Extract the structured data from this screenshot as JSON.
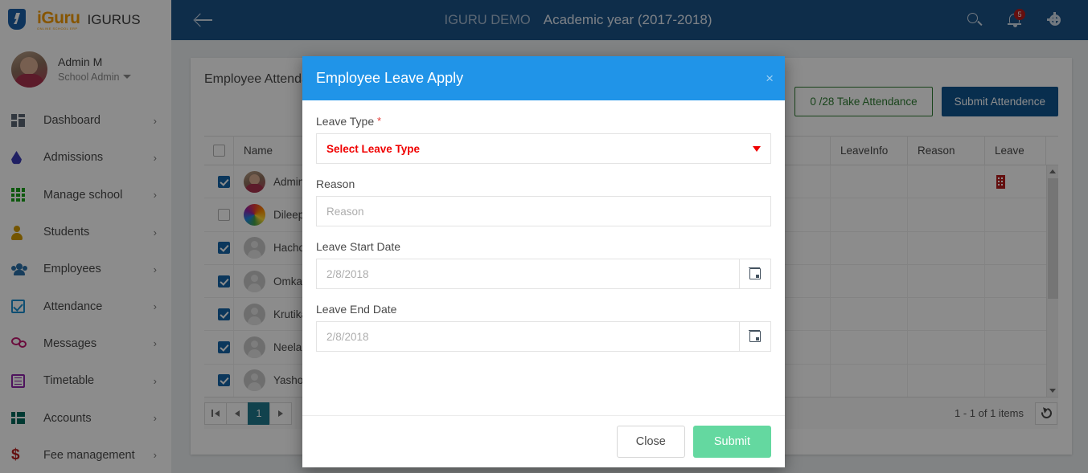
{
  "brand": {
    "logo_text": "iGuru",
    "logo_sub": "ONLINE SCHOOL ERP",
    "name": "IGURUS"
  },
  "user": {
    "name": "Admin M",
    "role": "School Admin"
  },
  "sidebar": {
    "items": [
      {
        "label": "Dashboard",
        "icon": "dashboard-icon"
      },
      {
        "label": "Admissions",
        "icon": "droplet-icon"
      },
      {
        "label": "Manage school",
        "icon": "grid-icon"
      },
      {
        "label": "Students",
        "icon": "user-icon"
      },
      {
        "label": "Employees",
        "icon": "group-icon"
      },
      {
        "label": "Attendance",
        "icon": "checkbox-icon"
      },
      {
        "label": "Messages",
        "icon": "chat-icon"
      },
      {
        "label": "Timetable",
        "icon": "table-icon"
      },
      {
        "label": "Accounts",
        "icon": "accounts-icon"
      },
      {
        "label": "Fee management",
        "icon": "dollar-icon"
      }
    ],
    "arrow": "›"
  },
  "header": {
    "back_icon": "back-arrow-icon",
    "demo": "IGURU DEMO",
    "academic_year": "Academic year (2017-2018)",
    "search_icon": "search-icon",
    "bell_icon": "bell-icon",
    "notification_count": "5",
    "gear_icon": "gear-icon"
  },
  "card": {
    "title": "Employee Attendance",
    "take_attendance": "0 /28 Take Attendance",
    "submit_attendance": "Submit Attendence"
  },
  "table": {
    "headers": [
      "Name",
      "LeaveInfo",
      "Reason",
      "Leave"
    ],
    "rows": [
      {
        "checked": true,
        "avatar": "photo",
        "name": "Admin M",
        "leaveinfo": "",
        "reason": "",
        "leave_icon": "leave-building-icon"
      },
      {
        "checked": false,
        "avatar": "rainbow",
        "name": "Dileep",
        "leaveinfo": "",
        "reason": "",
        "leave_icon": ""
      },
      {
        "checked": true,
        "avatar": "ph",
        "name": "Hachole",
        "leaveinfo": "",
        "reason": "",
        "leave_icon": ""
      },
      {
        "checked": true,
        "avatar": "ph",
        "name": "Omkar",
        "leaveinfo": "",
        "reason": "",
        "leave_icon": ""
      },
      {
        "checked": true,
        "avatar": "ph",
        "name": "Krutika",
        "leaveinfo": "",
        "reason": "",
        "leave_icon": ""
      },
      {
        "checked": true,
        "avatar": "ph",
        "name": "Neelam",
        "leaveinfo": "",
        "reason": "",
        "leave_icon": ""
      },
      {
        "checked": true,
        "avatar": "ph",
        "name": "Yashoda",
        "leaveinfo": "",
        "reason": "",
        "leave_icon": ""
      }
    ]
  },
  "pagination": {
    "first": "⏮",
    "prev": "◀",
    "page": "1",
    "next": "▶",
    "items_text": "1 - 1 of 1 items",
    "refresh_icon": "refresh-icon"
  },
  "modal": {
    "title": "Employee Leave Apply",
    "close_x": "×",
    "leave_type_label": "Leave Type",
    "required_mark": "*",
    "leave_type_value": "Select Leave Type",
    "reason_label": "Reason",
    "reason_placeholder": "Reason",
    "reason_value": "",
    "start_label": "Leave Start Date",
    "start_value": "2/8/2018",
    "end_label": "Leave End Date",
    "end_value": "2/8/2018",
    "calendar_icon": "calendar-icon",
    "close_button": "Close",
    "submit_button": "Submit"
  },
  "colors": {
    "header_blue": "#1b5288",
    "modal_blue": "#2094e8",
    "submit_green": "#64d8a0",
    "required_red": "#f00000",
    "page_active_teal": "#20788c",
    "attendance_blue": "#10548f",
    "take_green": "#2e7d32"
  }
}
